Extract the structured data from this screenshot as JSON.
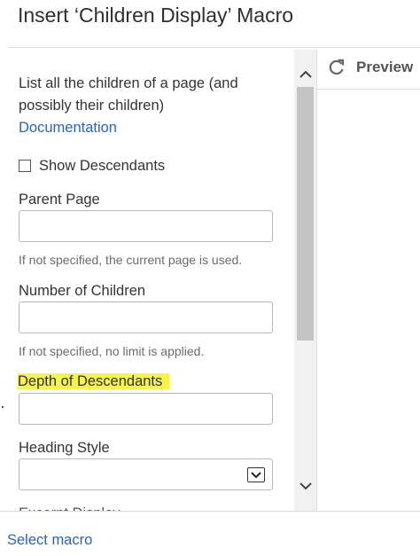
{
  "dialog": {
    "title": "Insert ‘Children Display’ Macro"
  },
  "form": {
    "description": "List all the children of a page (and possibly their children)",
    "documentation_link": "Documentation",
    "show_descendants": {
      "label": "Show Descendants",
      "checked": false
    },
    "parent_page": {
      "label": "Parent Page",
      "value": "",
      "hint": "If not specified, the current page is used."
    },
    "number_of_children": {
      "label": "Number of Children",
      "value": "",
      "hint": "If not specified, no limit is applied."
    },
    "depth_of_descendants": {
      "label": "Depth of Descendants",
      "value": ""
    },
    "heading_style": {
      "label": "Heading Style",
      "selected": ""
    },
    "next_field_label_partial": "Excerpt Display"
  },
  "preview": {
    "label": "Preview"
  },
  "footer": {
    "select_macro_link": "Select macro"
  },
  "colors": {
    "link": "#2a64b8",
    "highlight": "#f6f34a"
  }
}
